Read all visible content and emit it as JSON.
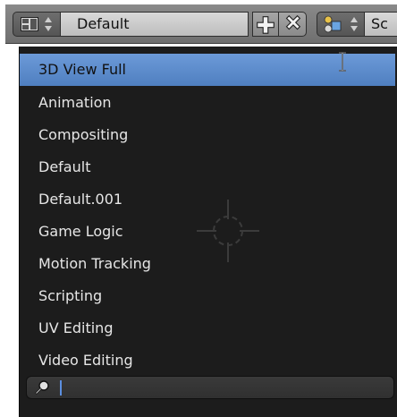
{
  "header": {
    "layout_icon": "screen-layout-icon",
    "layout_name": "Default",
    "add_icon": "plus-icon",
    "remove_icon": "x-icon",
    "scene_icon": "scene-icon",
    "scene_name_partial": "Sc"
  },
  "menu": {
    "items": [
      {
        "label": "3D View Full",
        "active": true
      },
      {
        "label": "Animation",
        "active": false
      },
      {
        "label": "Compositing",
        "active": false
      },
      {
        "label": "Default",
        "active": false
      },
      {
        "label": "Default.001",
        "active": false
      },
      {
        "label": "Game Logic",
        "active": false
      },
      {
        "label": "Motion Tracking",
        "active": false
      },
      {
        "label": "Scripting",
        "active": false
      },
      {
        "label": "UV Editing",
        "active": false
      },
      {
        "label": "Video Editing",
        "active": false
      }
    ],
    "search": {
      "icon": "magnifier-icon",
      "value": ""
    }
  },
  "colors": {
    "menu_bg": "#1c1c1c",
    "highlight": "#5b8bd0",
    "header_bg": "#7a7a7a",
    "text": "#e6e6e6"
  }
}
